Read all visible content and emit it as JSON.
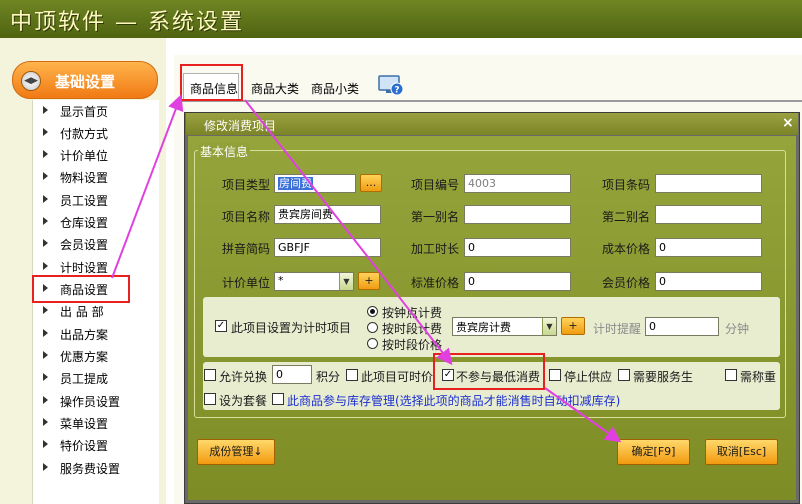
{
  "app": {
    "title": "中顶软件 — 系统设置"
  },
  "sidebar": {
    "section": "基础设置",
    "items": [
      {
        "label": "显示首页"
      },
      {
        "label": "付款方式"
      },
      {
        "label": "计价单位"
      },
      {
        "label": "物料设置"
      },
      {
        "label": "员工设置"
      },
      {
        "label": "仓库设置"
      },
      {
        "label": "会员设置"
      },
      {
        "label": "计时设置"
      },
      {
        "label": "商品设置"
      },
      {
        "label": "出 品 部"
      },
      {
        "label": "出品方案"
      },
      {
        "label": "优惠方案"
      },
      {
        "label": "员工提成"
      },
      {
        "label": "操作员设置"
      },
      {
        "label": "菜单设置"
      },
      {
        "label": "特价设置"
      },
      {
        "label": "服务费设置"
      }
    ]
  },
  "tabs": [
    {
      "label": "商品信息"
    },
    {
      "label": "商品大类"
    },
    {
      "label": "商品小类"
    }
  ],
  "dialog": {
    "title": "修改消费项目",
    "close": "×",
    "group_label": "基本信息",
    "fields": {
      "item_type": {
        "label": "项目类型",
        "value": "房间费",
        "button": "..."
      },
      "item_code": {
        "label": "项目编号",
        "value": "4003"
      },
      "item_barcode": {
        "label": "项目条码",
        "value": ""
      },
      "item_name": {
        "label": "项目名称",
        "value": "贵宾房间费"
      },
      "alias1": {
        "label": "第一别名",
        "value": ""
      },
      "alias2": {
        "label": "第二别名",
        "value": ""
      },
      "pinyin": {
        "label": "拼音简码",
        "value": "GBFJF"
      },
      "process_time": {
        "label": "加工时长",
        "value": "0"
      },
      "cost_price": {
        "label": "成本价格",
        "value": "0"
      },
      "unit": {
        "label": "计价单位",
        "value": "*",
        "button": "+"
      },
      "std_price": {
        "label": "标准价格",
        "value": "0"
      },
      "member_price": {
        "label": "会员价格",
        "value": "0"
      }
    },
    "timing": {
      "checkbox_label": "此项目设置为计时项目",
      "checked": true,
      "radios": [
        {
          "label": "按钟点计费",
          "selected": true
        },
        {
          "label": "按时段计费",
          "selected": false
        },
        {
          "label": "按时段价格",
          "selected": false
        }
      ],
      "period_select": "贵宾房计费",
      "add_button": "+",
      "reminder_label": "计时提醒",
      "reminder_value": "0",
      "reminder_unit": "分钟"
    },
    "options": {
      "allow_exchange": {
        "label": "允许兑换",
        "checked": false
      },
      "points_value": "0",
      "points_unit": "积分",
      "time_item": {
        "label": "此项目可时价",
        "checked": false
      },
      "no_min_charge": {
        "label": "不参与最低消费",
        "checked": true
      },
      "stop_supply": {
        "label": "停止供应",
        "checked": false
      },
      "need_service": {
        "label": "需要服务生",
        "checked": false
      },
      "need_weigh": {
        "label": "需称重",
        "checked": false
      },
      "set_package": {
        "label": "设为套餐",
        "checked": false
      },
      "inventory": {
        "label": "此商品参与库存管理(选择此项的商品才能消售时自动扣减库存)",
        "checked": false
      }
    },
    "buttons": {
      "component": "成份管理↓",
      "ok": "确定[F9]",
      "cancel": "取消[Esc]"
    }
  },
  "colors": {
    "title_bar": "#5a6e18",
    "dialog_body": "#8a9832",
    "orange_button": "#f4a020",
    "annotation_red": "#e82020",
    "annotation_arrow": "#e040e0"
  }
}
